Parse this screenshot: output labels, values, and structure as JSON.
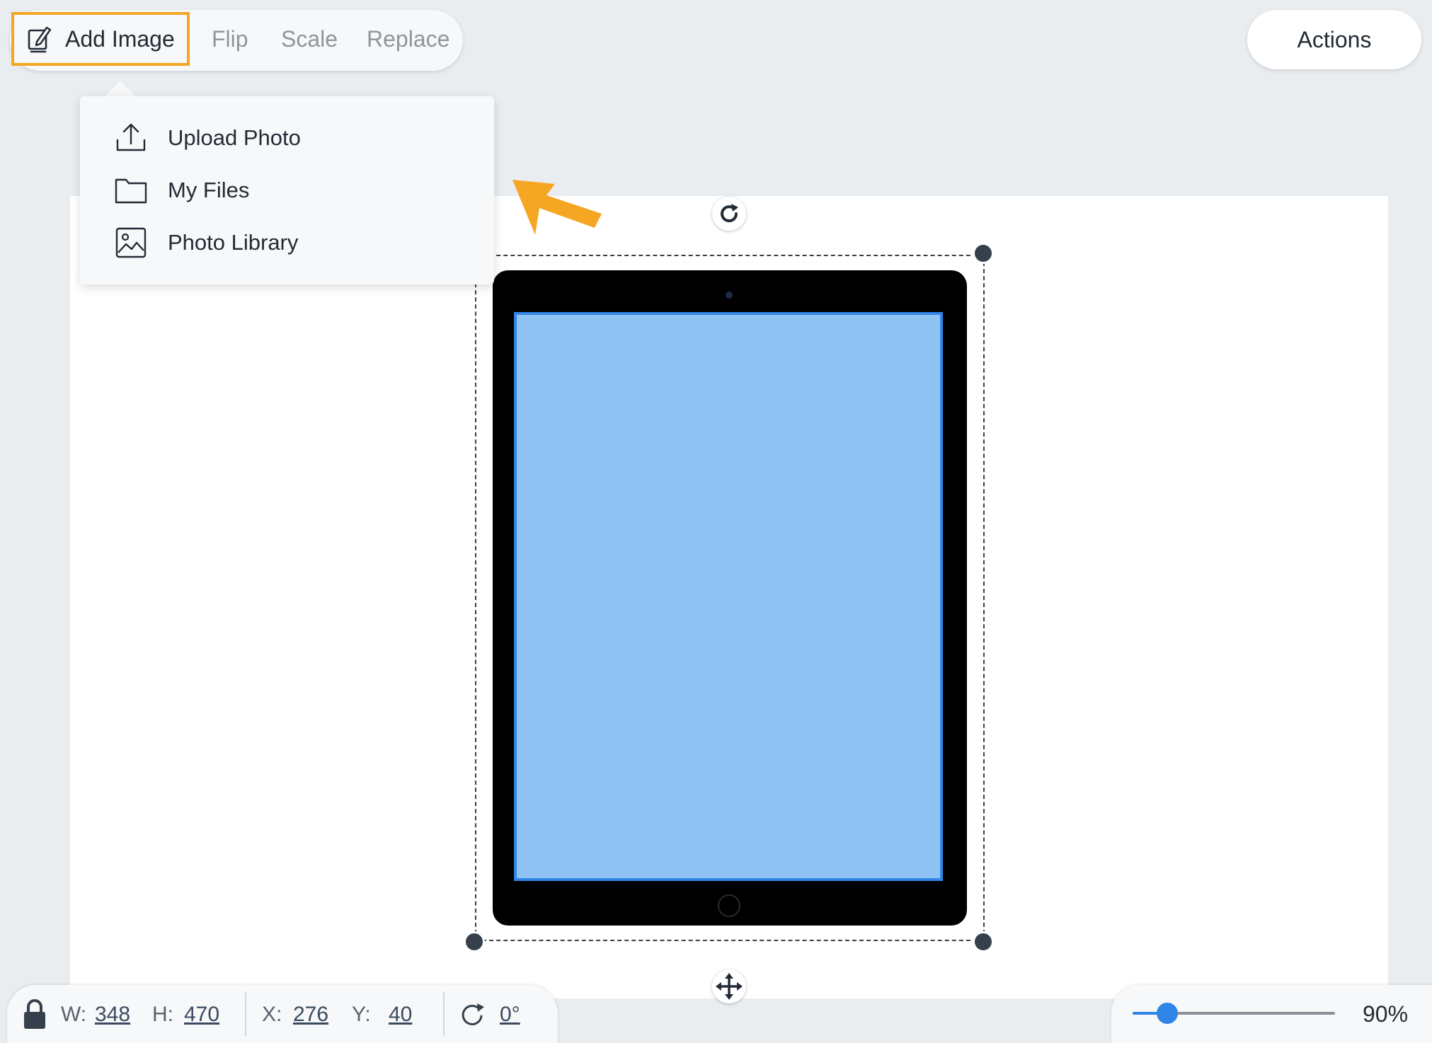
{
  "toolbar": {
    "add_image_label": "Add Image",
    "flip_label": "Flip",
    "scale_label": "Scale",
    "replace_label": "Replace"
  },
  "actions_label": "Actions",
  "dropdown": {
    "items": [
      {
        "label": "Upload Photo",
        "icon": "upload-icon"
      },
      {
        "label": "My Files",
        "icon": "folder-icon"
      },
      {
        "label": "Photo Library",
        "icon": "image-icon"
      }
    ]
  },
  "status_bar": {
    "w_label": "W:",
    "w_value": "348",
    "h_label": "H:",
    "h_value": "470",
    "x_label": "X:",
    "x_value": "276",
    "y_label": "Y:",
    "y_value": "40",
    "rotation_value": "0°"
  },
  "zoom": {
    "value_label": "90%",
    "level": 0.17
  },
  "colors": {
    "highlight": "#f5a623",
    "accent": "#2f86e6",
    "screen": "#8fc3f3",
    "pointer_arrow": "#f5a623"
  }
}
